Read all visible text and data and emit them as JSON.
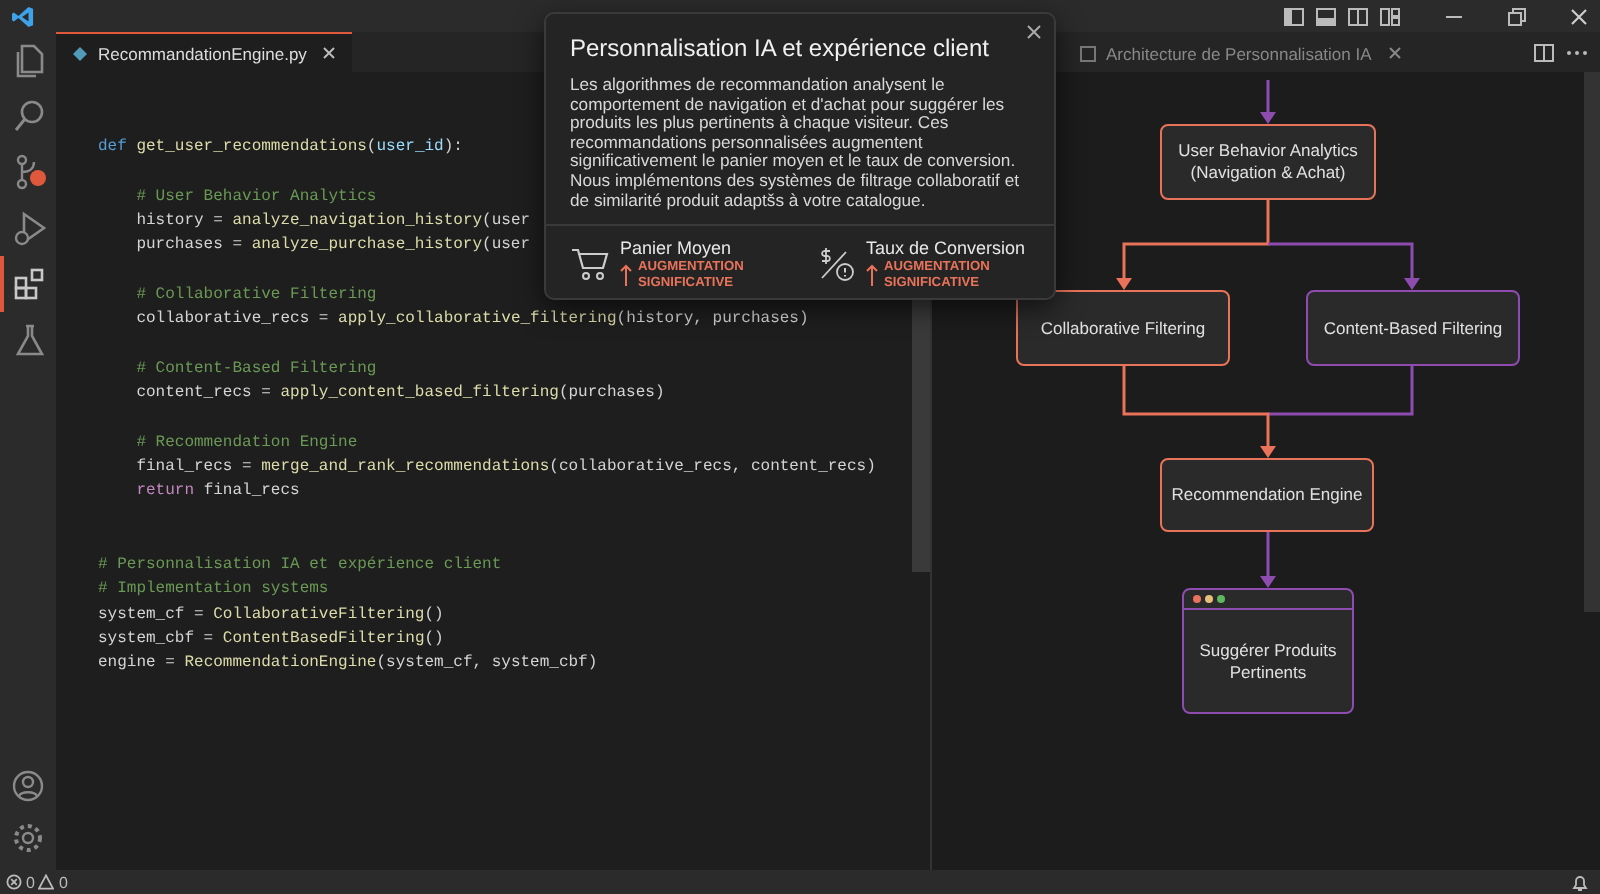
{
  "activity_bar": [
    {
      "kind": "files",
      "selected": false
    },
    {
      "kind": "search",
      "selected": false
    },
    {
      "kind": "source-control",
      "selected": false
    },
    {
      "kind": "run",
      "selected": false
    },
    {
      "kind": "extensions",
      "selected": true
    },
    {
      "kind": "flask",
      "selected": false
    }
  ],
  "editor": {
    "tab": {
      "label": "RecommandationEngine.py",
      "selected": true
    },
    "lines": [
      {
        "kind": "code",
        "tokens": [
          {
            "text": "def ",
            "kind": "keyword"
          },
          {
            "text": "get_user_recommendations",
            "kind": "function"
          },
          {
            "text": "(",
            "kind": "plain"
          },
          {
            "text": "user_id",
            "kind": "param"
          },
          {
            "text": "):",
            "kind": "plain"
          }
        ]
      },
      {
        "kind": "blank"
      },
      {
        "kind": "code",
        "tokens": [
          {
            "text": "    # User Behavior Analytics",
            "kind": "comment"
          }
        ]
      },
      {
        "kind": "code",
        "tokens": [
          {
            "text": "    history = ",
            "kind": "plain"
          },
          {
            "text": "analyze_navigation_history",
            "kind": "function"
          },
          {
            "text": "(user",
            "kind": "plain"
          }
        ]
      },
      {
        "kind": "code",
        "tokens": [
          {
            "text": "    purchases = ",
            "kind": "plain"
          },
          {
            "text": "analyze_purchase_history",
            "kind": "function"
          },
          {
            "text": "(user",
            "kind": "plain"
          }
        ]
      },
      {
        "kind": "blank"
      },
      {
        "kind": "code",
        "tokens": [
          {
            "text": "    # Collaborative Filtering",
            "kind": "comment"
          }
        ]
      },
      {
        "kind": "code",
        "tokens": [
          {
            "text": "    collaborative_recs = ",
            "kind": "plain"
          },
          {
            "text": "apply_collaborative_filtering",
            "kind": "function"
          },
          {
            "text": "(history, purchases)",
            "kind": "plain"
          }
        ]
      },
      {
        "kind": "blank"
      },
      {
        "kind": "code",
        "tokens": [
          {
            "text": "    # Content-Based Filtering",
            "kind": "comment"
          }
        ]
      },
      {
        "kind": "code",
        "tokens": [
          {
            "text": "    content_recs = ",
            "kind": "plain"
          },
          {
            "text": "apply_content_based_filtering",
            "kind": "function"
          },
          {
            "text": "(purchases)",
            "kind": "plain"
          }
        ]
      },
      {
        "kind": "blank"
      },
      {
        "kind": "code",
        "tokens": [
          {
            "text": "    # Recommendation Engine",
            "kind": "comment"
          }
        ]
      },
      {
        "kind": "code",
        "tokens": [
          {
            "text": "    final_recs = ",
            "kind": "plain"
          },
          {
            "text": "merge_and_rank_recommendations",
            "kind": "function"
          },
          {
            "text": "(collaborative_recs, content_recs)",
            "kind": "plain"
          }
        ]
      },
      {
        "kind": "code",
        "tokens": [
          {
            "text": "    return",
            "kind": "control"
          },
          {
            "text": " final_recs",
            "kind": "plain"
          }
        ]
      },
      {
        "kind": "blank"
      },
      {
        "kind": "blank"
      },
      {
        "kind": "code",
        "tokens": [
          {
            "text": "# Personnalisation IA et expérience client",
            "kind": "comment"
          }
        ]
      },
      {
        "kind": "code",
        "tokens": [
          {
            "text": "# Implementation systems",
            "kind": "comment"
          }
        ]
      },
      {
        "kind": "code",
        "tokens": [
          {
            "text": "system_cf = ",
            "kind": "plain"
          },
          {
            "text": "CollaborativeFiltering",
            "kind": "function"
          },
          {
            "text": "()",
            "kind": "plain"
          }
        ]
      },
      {
        "kind": "code",
        "tokens": [
          {
            "text": "system_cbf = ",
            "kind": "plain"
          },
          {
            "text": "ContentBasedFiltering",
            "kind": "function"
          },
          {
            "text": "()",
            "kind": "plain"
          }
        ]
      },
      {
        "kind": "code",
        "tokens": [
          {
            "text": "engine = ",
            "kind": "plain"
          },
          {
            "text": "RecommendationEngine",
            "kind": "function"
          },
          {
            "text": "(system_cf, system_cbf)",
            "kind": "plain"
          }
        ]
      }
    ]
  },
  "preview": {
    "tab": {
      "label": "Architecture de Personnalisation IA",
      "selected": false
    },
    "nodes": [
      {
        "kind": "box",
        "label": "User Behavior Analytics (Navigation & Achat)",
        "color": "#e8735a"
      },
      {
        "kind": "box",
        "label": "Collaborative Filtering",
        "color": "#e8735a"
      },
      {
        "kind": "box",
        "label": "Content-Based Filtering",
        "color": "#8e4bb0"
      },
      {
        "kind": "box",
        "label": "Recommendation Engine",
        "color": "#e8735a"
      },
      {
        "kind": "window",
        "label": "Suggérer Produits Pertinents",
        "color": "#8e4bb0"
      }
    ]
  },
  "popup": {
    "title": "Personnalisation IA et expérience client",
    "body": "Les algorithmes de recommandation analysent le comportement de navigation et d'achat pour suggérer les produits les plus pertinents à chaque visiteur. Ces recommandations personnalisées augmentent significativement le panier moyen et le taux de conversion. Nous implémentons des systèmes de filtrage collaboratif et de similarité produit adaptšs à votre catalogue.",
    "metrics": [
      {
        "kind": "cart",
        "label": "Panier Moyen",
        "trend": "AUGMENTATION SIGNIFICATIVE"
      },
      {
        "kind": "conversion",
        "label": "Taux de Conversion",
        "trend": "AUGMENTATION SIGNIFICATIVE"
      }
    ]
  },
  "status_bar": {
    "errors": "0",
    "warnings": "0"
  }
}
